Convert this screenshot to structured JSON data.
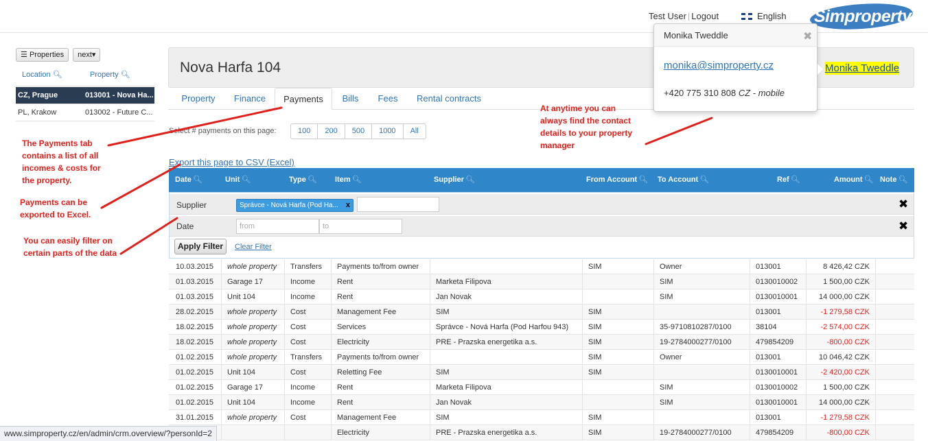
{
  "topbar": {
    "user": "Test User",
    "logout": "Logout",
    "language": "English",
    "logo": "Simproperty"
  },
  "sidebar": {
    "properties_btn": "Properties",
    "next_btn": "next",
    "col_location": "Location",
    "col_property": "Property",
    "rows": [
      {
        "location": "CZ, Prague",
        "property": "013001 - Nova Ha..."
      },
      {
        "location": "PL, Krakow",
        "property": "013002 - Future C..."
      }
    ]
  },
  "header": {
    "title": "Nova Harfa 104",
    "contact_name": "Monika Tweddle"
  },
  "tabs": [
    "Property",
    "Finance",
    "Payments",
    "Bills",
    "Fees",
    "Rental contracts"
  ],
  "paging": {
    "label": "Select # payments on this page:",
    "options": [
      "100",
      "200",
      "500",
      "1000",
      "All"
    ]
  },
  "export_label": "Export this page to CSV (Excel)",
  "columns": [
    "Date",
    "Unit",
    "Type",
    "Item",
    "Supplier",
    "From Account",
    "To Account",
    "Ref",
    "Amount",
    "Note"
  ],
  "filter": {
    "supplier_label": "Supplier",
    "supplier_chip": "Správce - Nová Harfa (Pod Ha...",
    "chip_remove": "x",
    "date_label": "Date",
    "from_placeholder": "from",
    "to_placeholder": "to",
    "remove": "✖",
    "apply": "Apply Filter",
    "clear": "Clear Filter"
  },
  "rows": [
    {
      "date": "10.03.2015",
      "unit": "whole property",
      "type": "Transfers",
      "item": "Payments to/from owner",
      "supplier": "",
      "from": "SIM",
      "to": "Owner",
      "ref": "013001",
      "amount": "8 426,42 CZK",
      "neg": false
    },
    {
      "date": "01.03.2015",
      "unit": "Garage 17",
      "type": "Income",
      "item": "Rent",
      "supplier": "Marketa Filipova",
      "from": "",
      "to": "SIM",
      "ref": "0130010002",
      "amount": "1 500,00 CZK",
      "neg": false
    },
    {
      "date": "01.03.2015",
      "unit": "Unit 104",
      "type": "Income",
      "item": "Rent",
      "supplier": "Jan Novak",
      "from": "",
      "to": "SIM",
      "ref": "0130010001",
      "amount": "14 000,00 CZK",
      "neg": false
    },
    {
      "date": "28.02.2015",
      "unit": "whole property",
      "type": "Cost",
      "item": "Management Fee",
      "supplier": "SIM",
      "from": "SIM",
      "to": "",
      "ref": "013001",
      "amount": "-1 279,58 CZK",
      "neg": true
    },
    {
      "date": "18.02.2015",
      "unit": "whole property",
      "type": "Cost",
      "item": "Services",
      "supplier": "Správce - Nová Harfa (Pod Harfou 943)",
      "from": "SIM",
      "to": "35-9710810287/0100",
      "ref": "38104",
      "amount": "-2 574,00 CZK",
      "neg": true
    },
    {
      "date": "18.02.2015",
      "unit": "whole property",
      "type": "Cost",
      "item": "Electricity",
      "supplier": "PRE - Prazska energetika a.s.",
      "from": "SIM",
      "to": "19-2784000277/0100",
      "ref": "479854209",
      "amount": "-800,00 CZK",
      "neg": true
    },
    {
      "date": "01.02.2015",
      "unit": "whole property",
      "type": "Transfers",
      "item": "Payments to/from owner",
      "supplier": "",
      "from": "SIM",
      "to": "Owner",
      "ref": "013001",
      "amount": "10 046,42 CZK",
      "neg": false
    },
    {
      "date": "01.02.2015",
      "unit": "Unit 104",
      "type": "Cost",
      "item": "Reletting Fee",
      "supplier": "SIM",
      "from": "SIM",
      "to": "",
      "ref": "0130010001",
      "amount": "-2 420,00 CZK",
      "neg": true
    },
    {
      "date": "01.02.2015",
      "unit": "Garage 17",
      "type": "Income",
      "item": "Rent",
      "supplier": "Marketa Filipova",
      "from": "",
      "to": "SIM",
      "ref": "0130010002",
      "amount": "1 500,00 CZK",
      "neg": false
    },
    {
      "date": "01.02.2015",
      "unit": "Unit 104",
      "type": "Income",
      "item": "Rent",
      "supplier": "Jan Novak",
      "from": "",
      "to": "SIM",
      "ref": "0130010001",
      "amount": "14 000,00 CZK",
      "neg": false
    },
    {
      "date": "31.01.2015",
      "unit": "whole property",
      "type": "Cost",
      "item": "Management Fee",
      "supplier": "SIM",
      "from": "SIM",
      "to": "",
      "ref": "013001",
      "amount": "-1 279,58 CZK",
      "neg": true
    },
    {
      "date": "",
      "unit": "",
      "type": "",
      "item": "Electricity",
      "supplier": "PRE - Prazska energetika a.s.",
      "from": "SIM",
      "to": "19-2784000277/0100",
      "ref": "479854209",
      "amount": "-800,00 CZK",
      "neg": true
    }
  ],
  "popover": {
    "title": "Monika Tweddle",
    "email": "monika@simproperty.cz",
    "phone": "+420 775 310 808",
    "phone_type": "CZ - mobile"
  },
  "annotations": {
    "payments_tab": "The Payments tab contains a list of all incomes & costs for the property.",
    "export": "Payments can be exported to Excel.",
    "filter": "You can easily filter on certain parts of the data",
    "contact": "At anytime you can always find the contact details to your property manager"
  },
  "statusbar": "www.simproperty.cz/en/admin/crm.overview/?personId=2",
  "colors": {
    "accent": "#2f86c8",
    "annotation": "#e0201c",
    "negative": "#e0201c",
    "highlight": "#ffff00"
  }
}
